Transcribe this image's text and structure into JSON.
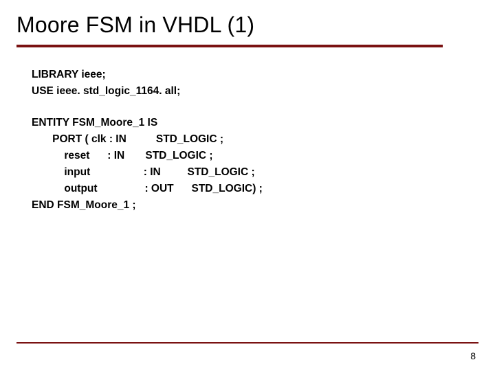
{
  "title": "Moore FSM in VHDL (1)",
  "code": {
    "l1": "LIBRARY ieee;",
    "l2": "USE ieee. std_logic_1164. all;",
    "l3": "ENTITY FSM_Moore_1 IS",
    "l4": "       PORT ( clk : IN          STD_LOGIC ;",
    "l5": "           reset      : IN       STD_LOGIC ;",
    "l6": "           input                  : IN         STD_LOGIC ;",
    "l7": "           output                : OUT      STD_LOGIC) ;",
    "l8": "END FSM_Moore_1 ;"
  },
  "page_number": "8"
}
